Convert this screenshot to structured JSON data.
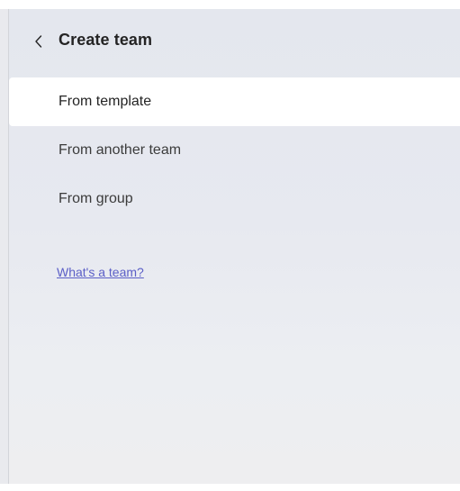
{
  "panel": {
    "title": "Create team",
    "back_icon": "chevron-left-icon"
  },
  "nav": {
    "items": [
      {
        "label": "From template",
        "selected": true
      },
      {
        "label": "From another team",
        "selected": false
      },
      {
        "label": "From group",
        "selected": false
      }
    ]
  },
  "help_link": {
    "label": "What's a team?"
  },
  "colors": {
    "panel_background": "#e4e7ee",
    "selected_background": "#ffffff",
    "link": "#5b5fc7",
    "text": "#242424"
  }
}
